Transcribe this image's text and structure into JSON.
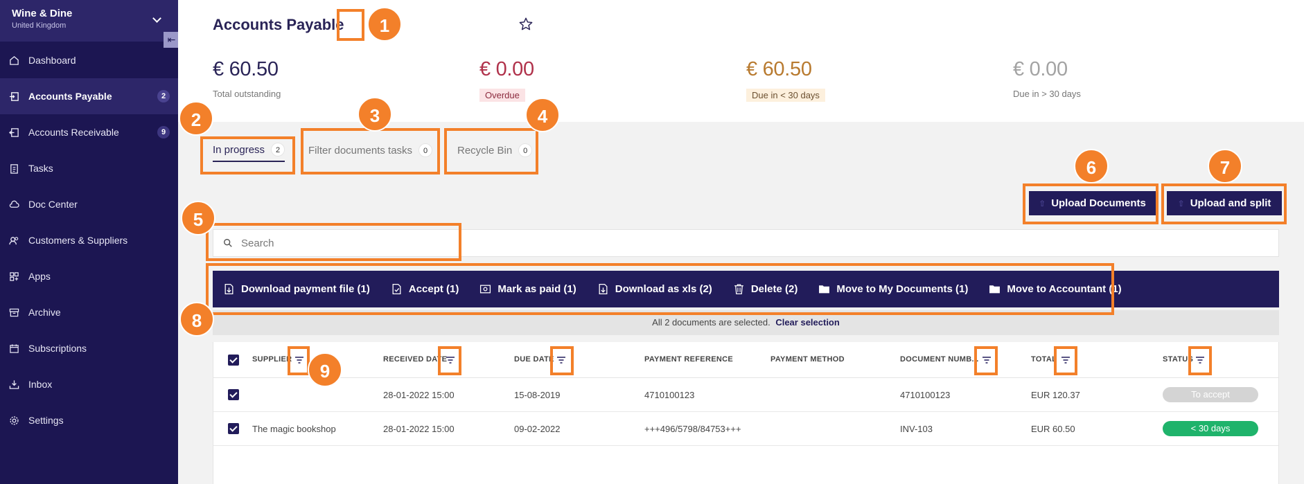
{
  "sidebar": {
    "company_name": "Wine & Dine",
    "company_country": "United Kingdom",
    "collapse_icon": "collapse-icon",
    "items": [
      {
        "label": "Dashboard",
        "icon": "home-icon"
      },
      {
        "label": "Accounts Payable",
        "icon": "payable-icon",
        "badge": "2",
        "active": true
      },
      {
        "label": "Accounts Receivable",
        "icon": "receivable-icon",
        "badge": "9"
      },
      {
        "label": "Tasks",
        "icon": "clipboard-icon"
      },
      {
        "label": "Doc Center",
        "icon": "cloud-icon"
      },
      {
        "label": "Customers & Suppliers",
        "icon": "users-icon"
      },
      {
        "label": "Apps",
        "icon": "apps-icon"
      },
      {
        "label": "Archive",
        "icon": "archive-icon"
      },
      {
        "label": "Subscriptions",
        "icon": "calendar-icon"
      },
      {
        "label": "Inbox",
        "icon": "inbox-icon"
      },
      {
        "label": "Settings",
        "icon": "gear-icon"
      }
    ]
  },
  "header": {
    "title": "Accounts Payable",
    "kpis": [
      {
        "value": "€ 60.50",
        "label": "Total outstanding",
        "color": "#2a2457"
      },
      {
        "value": "€ 0.00",
        "label": "Overdue",
        "color": "#b0324b",
        "label_bg": "#fbe3e5"
      },
      {
        "value": "€ 60.50",
        "label": "Due in < 30 days",
        "color": "#b87a2f",
        "label_bg": "#fdf0dd"
      },
      {
        "value": "€ 0.00",
        "label": "Due in > 30 days",
        "color": "#a3a3a3"
      }
    ]
  },
  "tabs": [
    {
      "label": "In progress",
      "count": "2",
      "active": true
    },
    {
      "label": "Filter documents tasks",
      "count": "0"
    },
    {
      "label": "Recycle Bin",
      "count": "0"
    }
  ],
  "buttons": {
    "upload_documents": "Upload Documents",
    "upload_split": "Upload and split"
  },
  "search": {
    "placeholder": "Search"
  },
  "actions": [
    {
      "label": "Download payment file (1)",
      "icon": "download-file-icon"
    },
    {
      "label": "Accept (1)",
      "icon": "accept-icon"
    },
    {
      "label": "Mark as paid (1)",
      "icon": "paid-icon"
    },
    {
      "label": "Download as xls (2)",
      "icon": "xls-icon"
    },
    {
      "label": "Delete (2)",
      "icon": "trash-icon"
    },
    {
      "label": "Move to My Documents (1)",
      "icon": "folder-icon"
    },
    {
      "label": "Move to Accountant (1)",
      "icon": "folder-icon"
    }
  ],
  "selection": {
    "text": "All 2 documents are selected.",
    "clear": "Clear selection"
  },
  "table": {
    "columns": [
      "SUPPLIER",
      "RECEIVED DATE",
      "DUE DATE",
      "PAYMENT REFERENCE",
      "PAYMENT METHOD",
      "DOCUMENT NUMB...",
      "TOTAL",
      "STATUS"
    ],
    "rows": [
      {
        "supplier": "",
        "received": "28-01-2022 15:00",
        "due": "15-08-2019",
        "reference": "4710100123",
        "method": "",
        "doc_number": "4710100123",
        "total": "EUR 120.37",
        "status": "To accept",
        "status_color": "#d4d4d4"
      },
      {
        "supplier": "The magic bookshop",
        "received": "28-01-2022 15:00",
        "due": "09-02-2022",
        "reference": "+++496/5798/84753+++",
        "method": "",
        "doc_number": "INV-103",
        "total": "EUR 60.50",
        "status": "< 30 days",
        "status_color": "#1fb36b"
      }
    ]
  },
  "annotations": {
    "color": "#f3802a",
    "markers": [
      "1",
      "2",
      "3",
      "4",
      "5",
      "6",
      "7",
      "8",
      "9"
    ]
  }
}
